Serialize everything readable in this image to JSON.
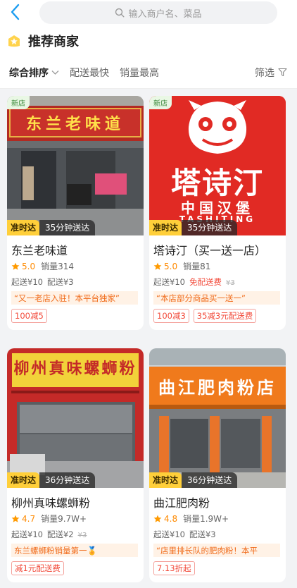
{
  "header": {
    "back_icon": "chevron-left-icon",
    "search_placeholder": "输入商户名、菜品",
    "section_title": "推荐商家",
    "section_icon": "star-badge-icon",
    "accent_color": "#1a9cf0"
  },
  "sort_bar": {
    "items": [
      "综合排序",
      "配送最快",
      "销量最高"
    ],
    "filter_label": "筛选"
  },
  "shops": [
    {
      "new_label": "新店",
      "sign_text": "东兰老味道",
      "ontime_label": "准时达",
      "delivery_time": "35分钟送达",
      "name": "东兰老味道",
      "rating": "5.0",
      "sales": "销量314",
      "min_order": "起送¥10",
      "delivery_fee": "配送¥3",
      "free_delivery": "",
      "original_fee": "",
      "slogan": "“又一老店入驻！本平台独家”",
      "promos": [
        "100减5"
      ]
    },
    {
      "new_label": "新店",
      "logo_main": "塔诗汀",
      "logo_sub": "中国汉堡",
      "logo_en": "TASHITING",
      "ontime_label": "准时达",
      "delivery_time": "35分钟送达",
      "name": "塔诗汀（买一送一店）",
      "rating": "5.0",
      "sales": "销量81",
      "min_order": "起送¥10",
      "delivery_fee": "",
      "free_delivery": "免配送费",
      "original_fee": "¥3",
      "slogan": "“本店部分商品买一送一”",
      "promos": [
        "100减3",
        "35减3元配送费"
      ]
    },
    {
      "new_label": "",
      "sign_text": "柳州真味螺蛳粉",
      "ontime_label": "准时达",
      "delivery_time": "36分钟送达",
      "name": "柳州真味螺蛳粉",
      "rating": "4.7",
      "sales": "销量9.7W+",
      "min_order": "起送¥10",
      "delivery_fee": "配送¥2",
      "free_delivery": "",
      "original_fee": "¥3",
      "slogan": "东兰螺蛳粉销量第一🏅",
      "promos": [
        "减1元配送费"
      ]
    },
    {
      "new_label": "",
      "sign_text": "曲江肥肉粉店",
      "ontime_label": "准时达",
      "delivery_time": "36分钟送达",
      "name": "曲江肥肉粉",
      "rating": "4.8",
      "sales": "销量1.9W+",
      "min_order": "起送¥10",
      "delivery_fee": "配送¥3",
      "free_delivery": "",
      "original_fee": "",
      "slogan": "“店里排长队的肥肉粉！本平",
      "promos": [
        "7.13折起"
      ]
    }
  ]
}
